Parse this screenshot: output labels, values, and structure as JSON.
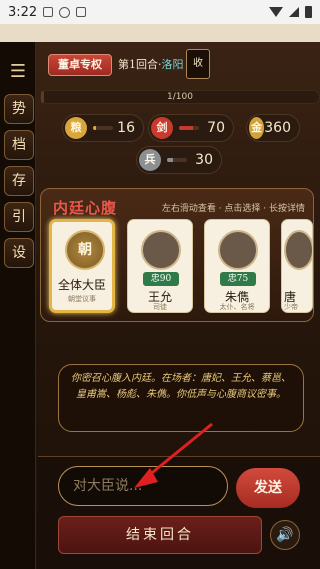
{
  "status_bar": {
    "time": "3:22"
  },
  "sidenav": {
    "menu_icon": "menu-icon",
    "items": [
      {
        "label": "势"
      },
      {
        "label": "档"
      },
      {
        "label": "存"
      },
      {
        "label": "引"
      },
      {
        "label": "设"
      }
    ]
  },
  "header": {
    "faction": "董卓专权",
    "round_prefix": "第1回合·",
    "city": "洛阳",
    "collect_label": "收"
  },
  "progress": {
    "text": "1/100",
    "value": 0.01
  },
  "stats": [
    {
      "icon_label": "粮",
      "value": "16",
      "color": "#d9a63c",
      "level": 0.16
    },
    {
      "icon_label": "剑",
      "value": "70",
      "color": "#c8392e",
      "level": 0.7
    },
    {
      "icon_label": "金",
      "value": "360",
      "color": "#d1a23a"
    },
    {
      "icon_label": "兵",
      "value": "30",
      "color": "#8a8f94",
      "level": 0.3
    }
  ],
  "inner_court": {
    "title": "内廷心腹",
    "hint": "左右滑动查看 · 点击选择 · 长按详情",
    "cards": [
      {
        "emblem": "朝",
        "name": "全体大臣",
        "role": "朝堂议事"
      },
      {
        "loyalty": "忠90",
        "name": "王允",
        "role": "司徒"
      },
      {
        "loyalty": "忠75",
        "name": "朱儁",
        "role": "太仆、名将"
      },
      {
        "name": "唐",
        "role": "少帝"
      }
    ]
  },
  "narrative": "你密召心腹入内廷。在场者：唐妃、王允、蔡邕、皇甫嵩、杨彪、朱儁。你低声与心腹商议密事。",
  "input": {
    "placeholder": "对大臣说..."
  },
  "buttons": {
    "send": "发送",
    "end_round": "结束回合"
  },
  "colors": {
    "accent": "#d24a3c",
    "gold": "#e2b545",
    "loyal_green": "#2f7a48"
  }
}
